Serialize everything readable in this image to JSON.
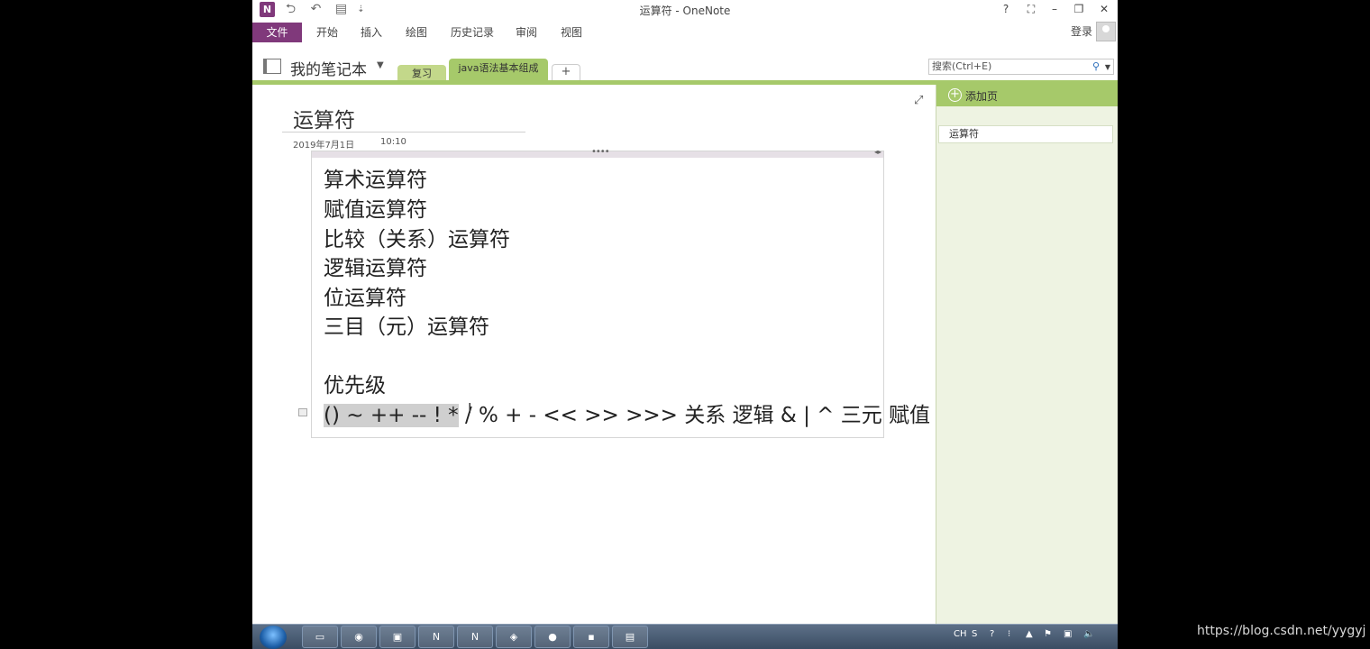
{
  "window": {
    "title": "运算符 - OneNote",
    "app_icon": "onenote-icon",
    "help": "?",
    "minimize": "–",
    "restore": "❐",
    "close": "✕",
    "fullscreen": "⛶"
  },
  "quick_access": {
    "back": "⮌",
    "undo": "↶",
    "dock": "▤",
    "customize": "⇣"
  },
  "ribbon": {
    "tabs": [
      "文件",
      "开始",
      "插入",
      "绘图",
      "历史记录",
      "审阅",
      "视图"
    ],
    "signin": "登录"
  },
  "notebook": {
    "name": "我的笔记本",
    "sections": [
      "复习",
      "java语法基本组成"
    ],
    "add_section": "+"
  },
  "search": {
    "placeholder": "搜索(Ctrl+E)"
  },
  "page": {
    "title": "运算符",
    "date": "2019年7月1日",
    "time": "10:10",
    "lines": [
      "算术运算符",
      "赋值运算符",
      "比较（关系）运算符",
      "逻辑运算符",
      "位运算符",
      "三目（元）运算符",
      "",
      "优先级"
    ],
    "priority_highlighted": "() ~ ++ -- ! *",
    "priority_rest": " / % + - << >> >>> 关系 逻辑 & | ^ 三元 赋值"
  },
  "pages_pane": {
    "add_page": "添加页",
    "pages": [
      "运算符"
    ]
  },
  "taskbar": {
    "tray_lang": "CH"
  },
  "watermark": "https://blog.csdn.net/yygyj",
  "colors": {
    "onenote_purple": "#80397b",
    "section_green": "#a6c96a",
    "highlight_gray": "#cfcfcf"
  }
}
